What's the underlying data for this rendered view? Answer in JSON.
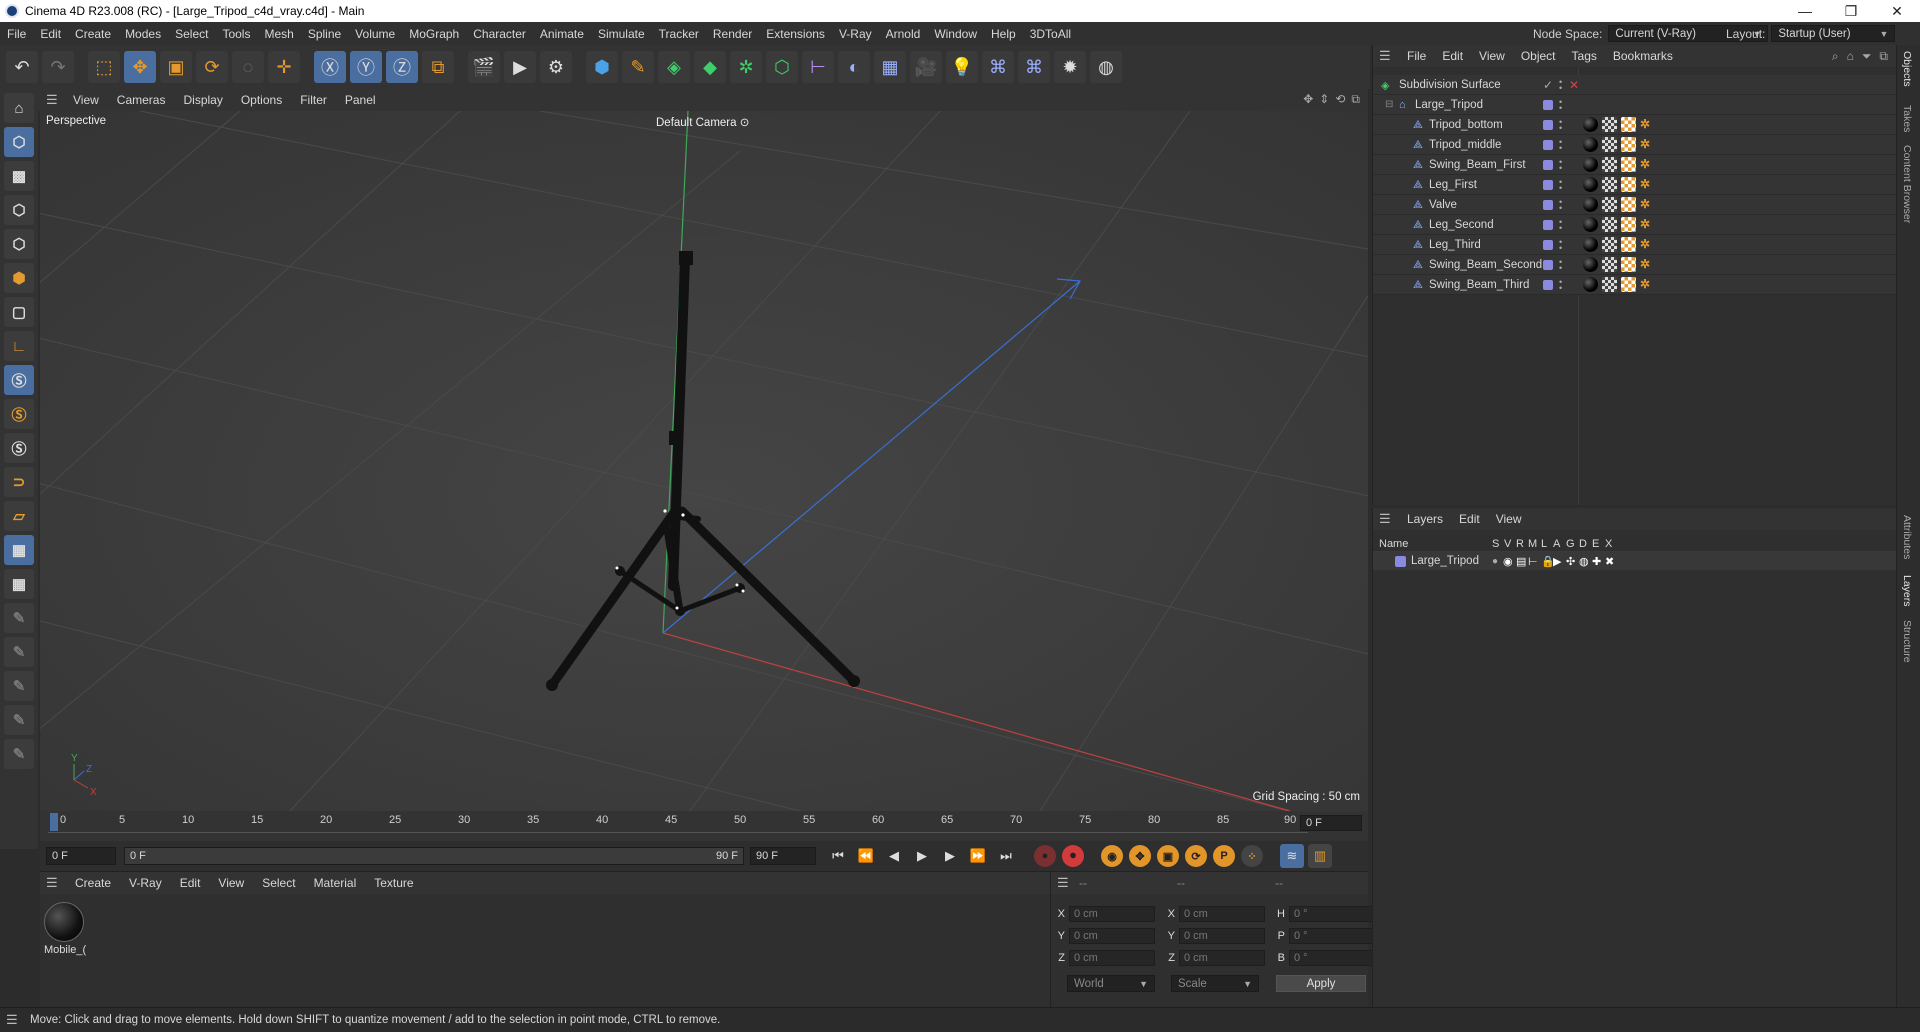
{
  "window": {
    "title": "Cinema 4D R23.008 (RC) - [Large_Tripod_c4d_vray.c4d] - Main",
    "controls": [
      "—",
      "❐",
      "✕"
    ]
  },
  "menubar": {
    "items": [
      "File",
      "Edit",
      "Create",
      "Modes",
      "Select",
      "Tools",
      "Mesh",
      "Spline",
      "Volume",
      "MoGraph",
      "Character",
      "Animate",
      "Simulate",
      "Tracker",
      "Render",
      "Extensions",
      "V-Ray",
      "Arnold",
      "Window",
      "Help",
      "3DToAll"
    ],
    "node_space_label": "Node Space:",
    "node_space_value": "Current (V-Ray)",
    "layout_label": "Layout:",
    "layout_value": "Startup (User)"
  },
  "viewport": {
    "menu": [
      "View",
      "Cameras",
      "Display",
      "Options",
      "Filter",
      "Panel"
    ],
    "view_name": "Perspective",
    "camera": "Default Camera",
    "grid_spacing": "Grid Spacing : 50 cm"
  },
  "timeline": {
    "ticks": [
      "0",
      "5",
      "10",
      "15",
      "20",
      "25",
      "30",
      "35",
      "40",
      "45",
      "50",
      "55",
      "60",
      "65",
      "70",
      "75",
      "80",
      "85",
      "90"
    ],
    "current_frame": "0 F"
  },
  "playbar": {
    "start": "0 F",
    "range_start": "0 F",
    "range_end": "90 F",
    "end": "90 F"
  },
  "material_panel": {
    "menu": [
      "Create",
      "V-Ray",
      "Edit",
      "View",
      "Select",
      "Material",
      "Texture"
    ],
    "material_name": "Mobile_("
  },
  "coord_panel": {
    "headers": [
      "--",
      "--",
      "--"
    ],
    "rows": [
      {
        "l1": "X",
        "v1": "0 cm",
        "l2": "X",
        "v2": "0 cm",
        "l3": "H",
        "v3": "0 °"
      },
      {
        "l1": "Y",
        "v1": "0 cm",
        "l2": "Y",
        "v2": "0 cm",
        "l3": "P",
        "v3": "0 °"
      },
      {
        "l1": "Z",
        "v1": "0 cm",
        "l2": "Z",
        "v2": "0 cm",
        "l3": "B",
        "v3": "0 °"
      }
    ],
    "mode": "World",
    "scale": "Scale",
    "apply": "Apply"
  },
  "status": "Move: Click and drag to move elements. Hold down SHIFT to quantize movement / add to the selection in point mode, CTRL to remove.",
  "object_manager": {
    "menu": [
      "File",
      "Edit",
      "View",
      "Object",
      "Tags",
      "Bookmarks"
    ],
    "objects": [
      {
        "name": "Subdivision Surface",
        "level": 0
      },
      {
        "name": "Large_Tripod",
        "level": 1
      },
      {
        "name": "Tripod_bottom",
        "level": 2
      },
      {
        "name": "Tripod_middle",
        "level": 2
      },
      {
        "name": "Swing_Beam_First",
        "level": 2
      },
      {
        "name": "Leg_First",
        "level": 2
      },
      {
        "name": "Valve",
        "level": 2
      },
      {
        "name": "Leg_Second",
        "level": 2
      },
      {
        "name": "Leg_Third",
        "level": 2
      },
      {
        "name": "Swing_Beam_Second",
        "level": 2
      },
      {
        "name": "Swing_Beam_Third",
        "level": 2
      }
    ]
  },
  "layer_manager": {
    "menu": [
      "Layers",
      "Edit",
      "View"
    ],
    "columns": [
      "Name",
      "S",
      "V",
      "R",
      "M",
      "L",
      "A",
      "G",
      "D",
      "E",
      "X"
    ],
    "layer_name": "Large_Tripod",
    "layer_color": "#8a8ae0"
  },
  "right_tabs": [
    "Objects",
    "Takes",
    "Content Browser",
    "Attributes",
    "Layers",
    "Structure"
  ],
  "colors": {
    "accent": "#4a6ea0",
    "axis_x": "#c24040",
    "axis_y": "#3fa85a",
    "axis_z": "#3a6fd6",
    "vray": "#e49a2e"
  }
}
